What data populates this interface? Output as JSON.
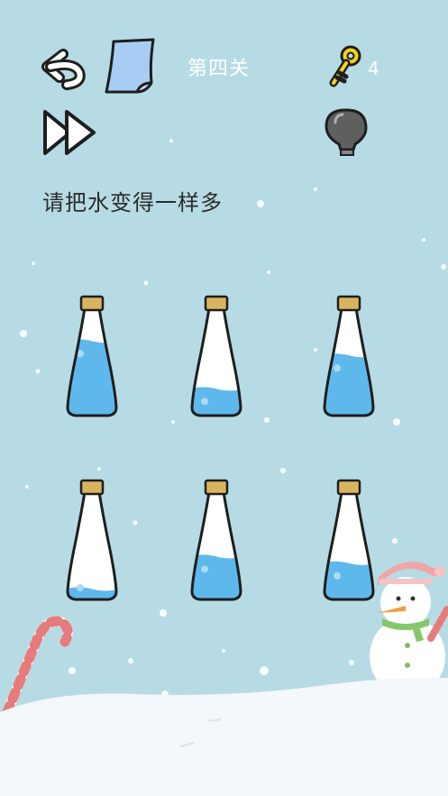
{
  "hud": {
    "level_title": "第四关",
    "keys": "4"
  },
  "instruction": "请把水变得一样多",
  "bottles": [
    {
      "id": 1,
      "fill": 0.77
    },
    {
      "id": 2,
      "fill": 0.27
    },
    {
      "id": 3,
      "fill": 0.62
    },
    {
      "id": 4,
      "fill": 0.1
    },
    {
      "id": 5,
      "fill": 0.44
    },
    {
      "id": 6,
      "fill": 0.37
    }
  ],
  "colors": {
    "sky": "#b7dbe4",
    "water": "#5fb8ec",
    "cap": "#d9b45f",
    "snow": "#f4f8fa"
  },
  "icons": [
    "undo-icon",
    "note-icon",
    "fast-forward-icon",
    "key-icon",
    "hint-bulb-icon"
  ]
}
